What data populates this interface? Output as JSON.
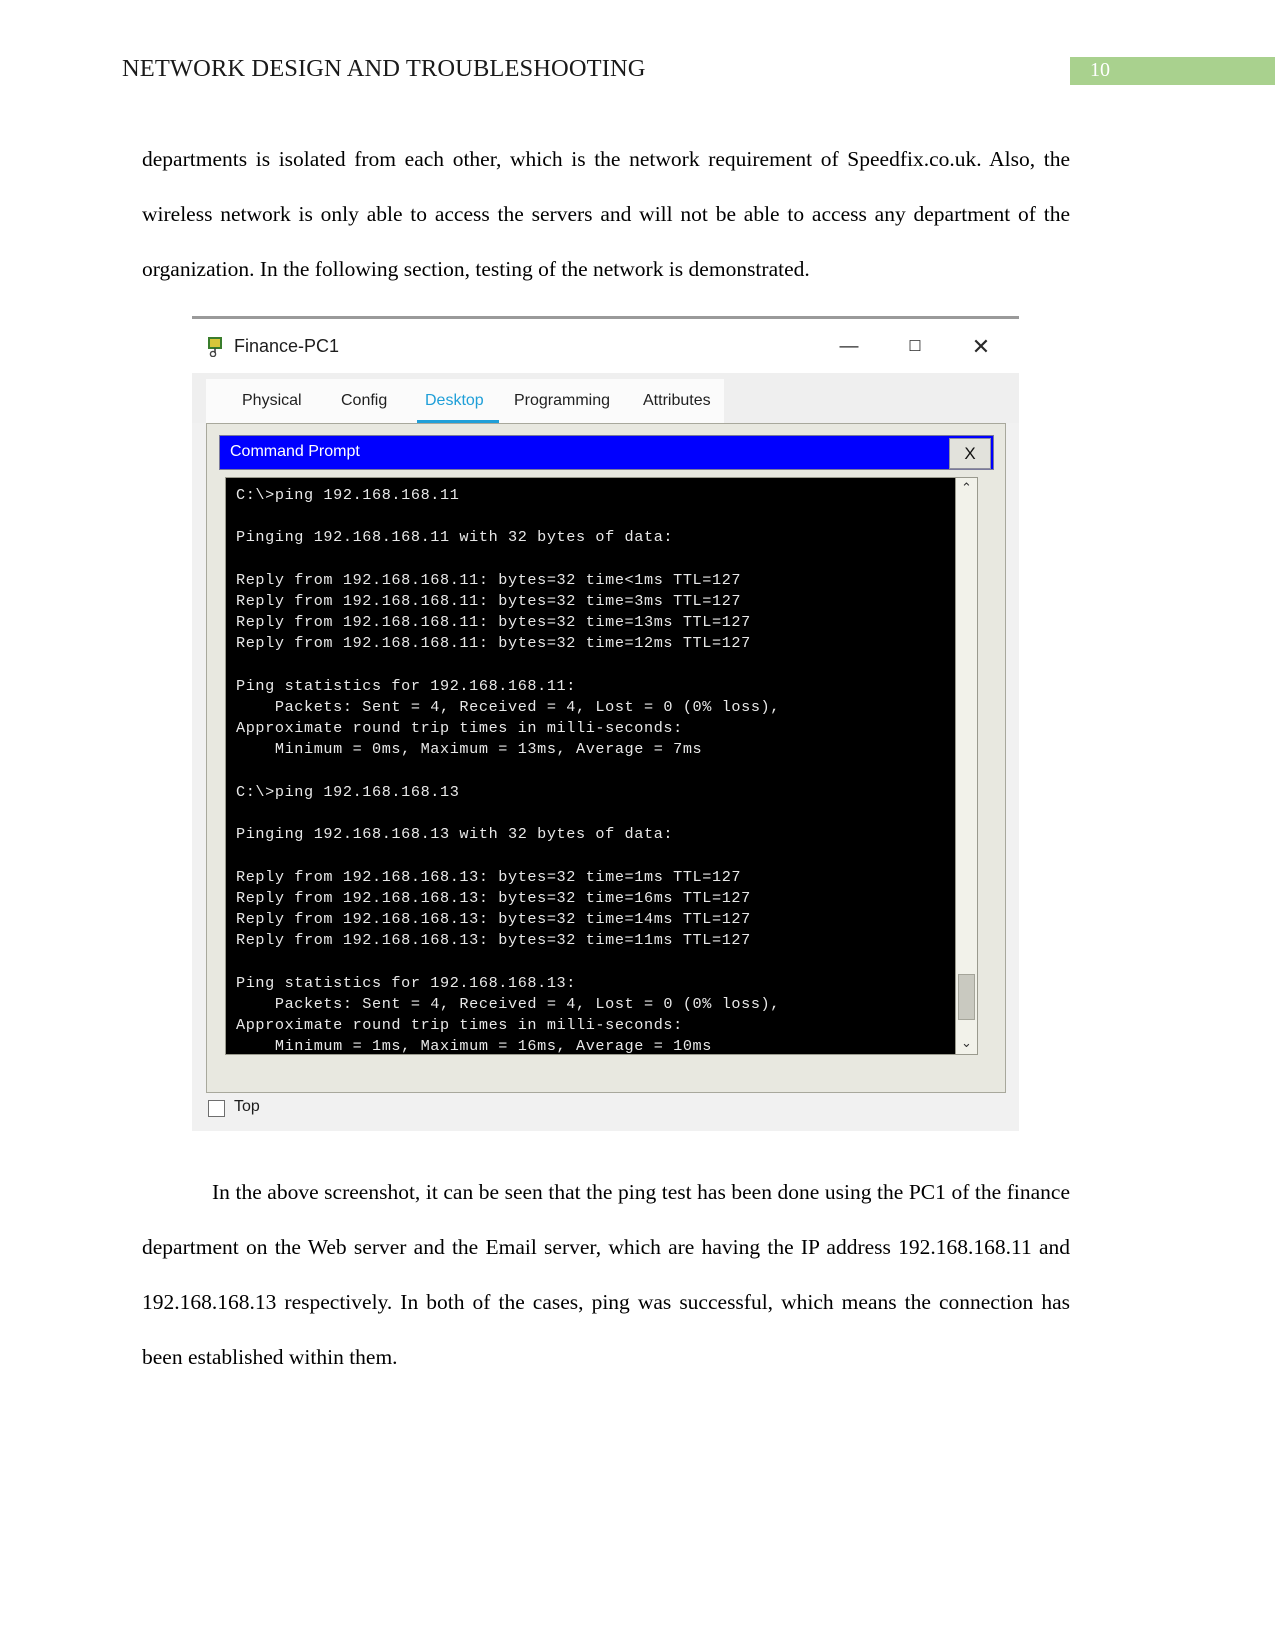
{
  "header": {
    "title": "NETWORK DESIGN AND TROUBLESHOOTING",
    "page_number": "10",
    "badge_color": "#a9d18e"
  },
  "body": {
    "paragraph_1": "departments is isolated from each other, which is the network requirement of Speedfix.co.uk. Also, the wireless network is only able to access the servers and will not be able to access any department of the organization. In the following section, testing of the network is demonstrated.",
    "paragraph_2": "In the above screenshot, it can be seen that the ping test has been done using the PC1 of the finance department on the Web server and the Email server, which are having the IP address 192.168.168.11 and 192.168.168.13 respectively. In both of the cases, ping was successful, which means the connection has been established within them."
  },
  "figure": {
    "window": {
      "title": "Finance-PC1",
      "icon": "device-icon",
      "minimize_label": "—",
      "maximize_label": "☐",
      "close_label": "✕"
    },
    "tabs": [
      {
        "label": "Physical",
        "active": false
      },
      {
        "label": "Config",
        "active": false
      },
      {
        "label": "Desktop",
        "active": true
      },
      {
        "label": "Programming",
        "active": false
      },
      {
        "label": "Attributes",
        "active": false
      }
    ],
    "active_tab_color": "#1f9fd8",
    "command_prompt": {
      "title": "Command Prompt",
      "titlebar_color": "#0000ff",
      "close_label": "X",
      "scrollbar": {
        "up_arrow": "⌃",
        "down_arrow": "⌄"
      },
      "console_output": "C:\\>ping 192.168.168.11\n\nPinging 192.168.168.11 with 32 bytes of data:\n\nReply from 192.168.168.11: bytes=32 time<1ms TTL=127\nReply from 192.168.168.11: bytes=32 time=3ms TTL=127\nReply from 192.168.168.11: bytes=32 time=13ms TTL=127\nReply from 192.168.168.11: bytes=32 time=12ms TTL=127\n\nPing statistics for 192.168.168.11:\n    Packets: Sent = 4, Received = 4, Lost = 0 (0% loss),\nApproximate round trip times in milli-seconds:\n    Minimum = 0ms, Maximum = 13ms, Average = 7ms\n\nC:\\>ping 192.168.168.13\n\nPinging 192.168.168.13 with 32 bytes of data:\n\nReply from 192.168.168.13: bytes=32 time=1ms TTL=127\nReply from 192.168.168.13: bytes=32 time=16ms TTL=127\nReply from 192.168.168.13: bytes=32 time=14ms TTL=127\nReply from 192.168.168.13: bytes=32 time=11ms TTL=127\n\nPing statistics for 192.168.168.13:\n    Packets: Sent = 4, Received = 4, Lost = 0 (0% loss),\nApproximate round trip times in milli-seconds:\n    Minimum = 1ms, Maximum = 16ms, Average = 10ms"
    },
    "bottom": {
      "checkbox_label": "Top",
      "checked": false
    }
  }
}
